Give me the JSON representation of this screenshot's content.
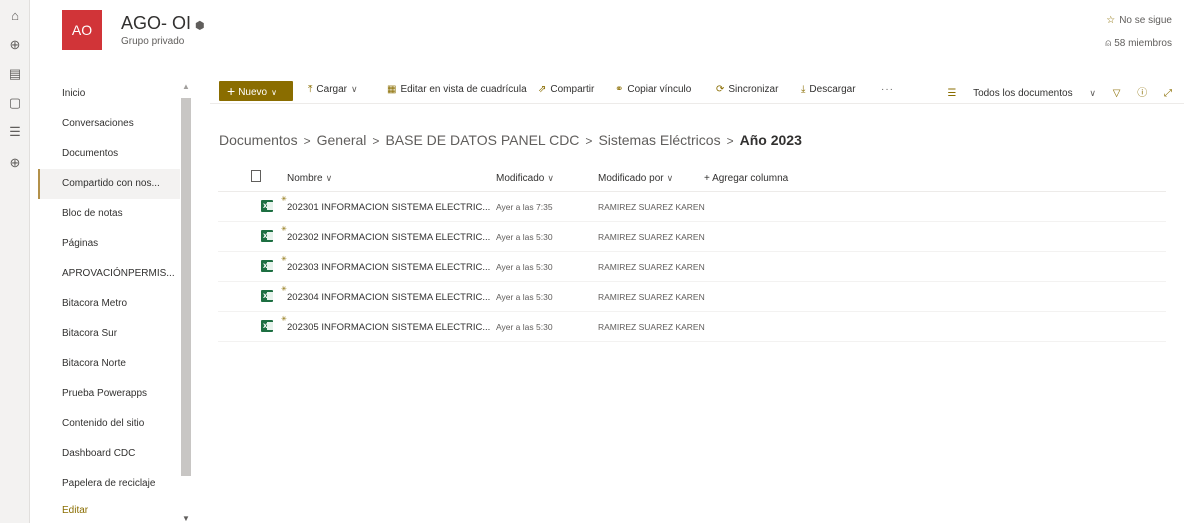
{
  "rail": {
    "icons": [
      "home-icon",
      "globe-icon",
      "news-icon",
      "file-icon",
      "list-icon",
      "add-icon"
    ]
  },
  "site": {
    "logo_text": "AO",
    "title": "AGO- OI",
    "subtitle": "Grupo privado",
    "follow_label": "No se sigue",
    "members_label": "58 miembros",
    "brand_color": "#8a6d00",
    "logo_color": "#d13438"
  },
  "nav": {
    "items": [
      {
        "label": "Inicio",
        "active": false
      },
      {
        "label": "Conversaciones",
        "active": false
      },
      {
        "label": "Documentos",
        "active": false
      },
      {
        "label": "Compartido con nos...",
        "active": true
      },
      {
        "label": "Bloc de notas",
        "active": false
      },
      {
        "label": "Páginas",
        "active": false
      },
      {
        "label": "APROVACIÓNPERMIS...",
        "active": false
      },
      {
        "label": "Bitacora Metro",
        "active": false
      },
      {
        "label": "Bitacora Sur",
        "active": false
      },
      {
        "label": "Bitacora Norte",
        "active": false
      },
      {
        "label": "Prueba Powerapps",
        "active": false
      },
      {
        "label": "Contenido del sitio",
        "active": false
      },
      {
        "label": "Dashboard CDC",
        "active": false
      },
      {
        "label": "Papelera de reciclaje",
        "active": false
      }
    ],
    "edit_label": "Editar"
  },
  "commandbar": {
    "new_label": "Nuevo",
    "upload_label": "Cargar",
    "grid_label": "Editar en vista de cuadrícula",
    "share_label": "Compartir",
    "copy_link_label": "Copiar vínculo",
    "sync_label": "Sincronizar",
    "download_label": "Descargar",
    "more_label": "···",
    "view_label": "Todos los documentos"
  },
  "breadcrumb": {
    "items": [
      "Documentos",
      "General",
      "BASE DE DATOS PANEL CDC",
      "Sistemas Eléctricos"
    ],
    "current": "Año 2023"
  },
  "list": {
    "columns": {
      "name": "Nombre",
      "modified": "Modificado",
      "modified_by": "Modificado por",
      "add_column": "+ Agregar columna"
    },
    "rows": [
      {
        "name": "202301 INFORMACION SISTEMA ELECTRIC...",
        "modified": "Ayer a las 7:35",
        "modified_by": "RAMIREZ SUAREZ KAREN"
      },
      {
        "name": "202302 INFORMACION SISTEMA ELECTRIC...",
        "modified": "Ayer a las 5:30",
        "modified_by": "RAMIREZ SUAREZ KAREN"
      },
      {
        "name": "202303 INFORMACION SISTEMA ELECTRIC...",
        "modified": "Ayer a las 5:30",
        "modified_by": "RAMIREZ SUAREZ KAREN"
      },
      {
        "name": "202304 INFORMACION SISTEMA ELECTRIC...",
        "modified": "Ayer a las 5:30",
        "modified_by": "RAMIREZ SUAREZ KAREN"
      },
      {
        "name": "202305 INFORMACION SISTEMA ELECTRIC...",
        "modified": "Ayer a las 5:30",
        "modified_by": "RAMIREZ SUAREZ KAREN"
      }
    ]
  }
}
